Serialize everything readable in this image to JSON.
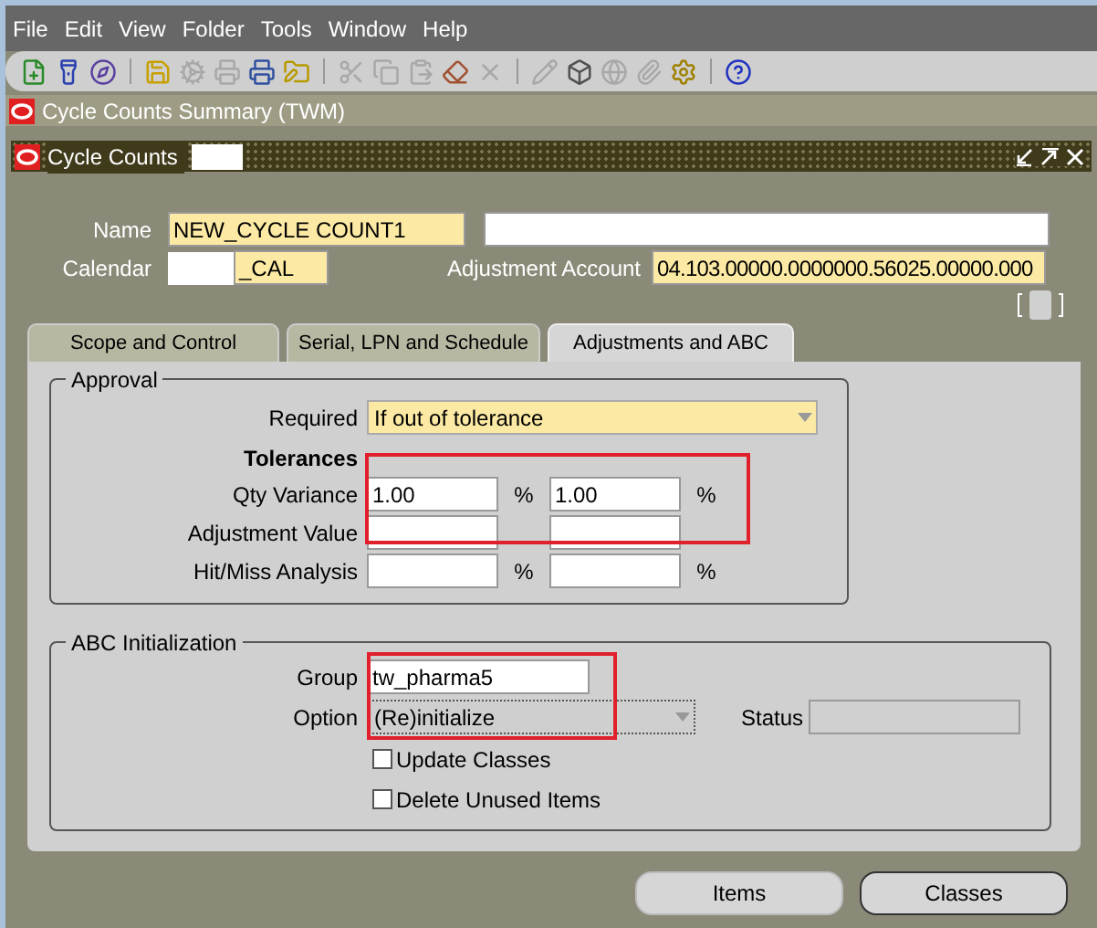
{
  "menu": [
    {
      "label": "File"
    },
    {
      "label": "Edit"
    },
    {
      "label": "View"
    },
    {
      "label": "Folder"
    },
    {
      "label": "Tools"
    },
    {
      "label": "Window"
    },
    {
      "label": "Help"
    }
  ],
  "toolbar": [
    {
      "disabled": false
    },
    {
      "disabled": false
    },
    {
      "disabled": false
    },
    {
      "disabled": false
    },
    {
      "disabled": true
    },
    {
      "disabled": true
    },
    {
      "disabled": false
    },
    {
      "disabled": false
    },
    {
      "disabled": true
    },
    {
      "disabled": true
    },
    {
      "disabled": true
    },
    {
      "disabled": false
    },
    {
      "disabled": true
    },
    {
      "disabled": true
    },
    {
      "disabled": false
    },
    {
      "disabled": true
    },
    {
      "disabled": true
    },
    {
      "disabled": false
    },
    {
      "disabled": false
    }
  ],
  "windows": [
    {
      "title": "Cycle Counts Summary (TWM)",
      "active": false
    },
    {
      "title": "Cycle Counts",
      "active": true
    }
  ],
  "header": {
    "name": {
      "label": "Name",
      "value": "NEW_CYCLE COUNT1"
    },
    "calendar": {
      "label": "Calendar",
      "value": "_CAL"
    },
    "adjustment_account": {
      "label": "Adjustment Account",
      "value": "04.103.00000.0000000.56025.00000.000"
    }
  },
  "tabs": [
    {
      "label": "Scope and Control",
      "selected": false
    },
    {
      "label": "Serial, LPN and Schedule",
      "selected": false
    },
    {
      "label": "Adjustments and ABC",
      "selected": true
    }
  ],
  "approval": {
    "title": "Approval",
    "required": {
      "label": "Required",
      "value": "If out of tolerance"
    },
    "tolerances_heading": "Tolerances",
    "rows": [
      {
        "label": "Qty Variance",
        "value_1": "1.00",
        "value_2": "1.00",
        "unit_1": "%",
        "unit_2": "%"
      },
      {
        "label": "Adjustment Value"
      },
      {
        "label": "Hit/Miss Analysis",
        "unit_1": "%",
        "unit_2": "%"
      }
    ]
  },
  "abc": {
    "title": "ABC Initialization",
    "group": {
      "label": "Group",
      "value": "tw_pharma5"
    },
    "option": {
      "label": "Option",
      "value": "(Re)initialize"
    },
    "status": {
      "label": "Status"
    },
    "checkboxes": [
      {
        "label": "Update Classes",
        "checked": false
      },
      {
        "label": "Delete Unused Items",
        "checked": false
      }
    ]
  },
  "buttons": [
    {
      "label": "Items"
    },
    {
      "label": "Classes"
    }
  ]
}
